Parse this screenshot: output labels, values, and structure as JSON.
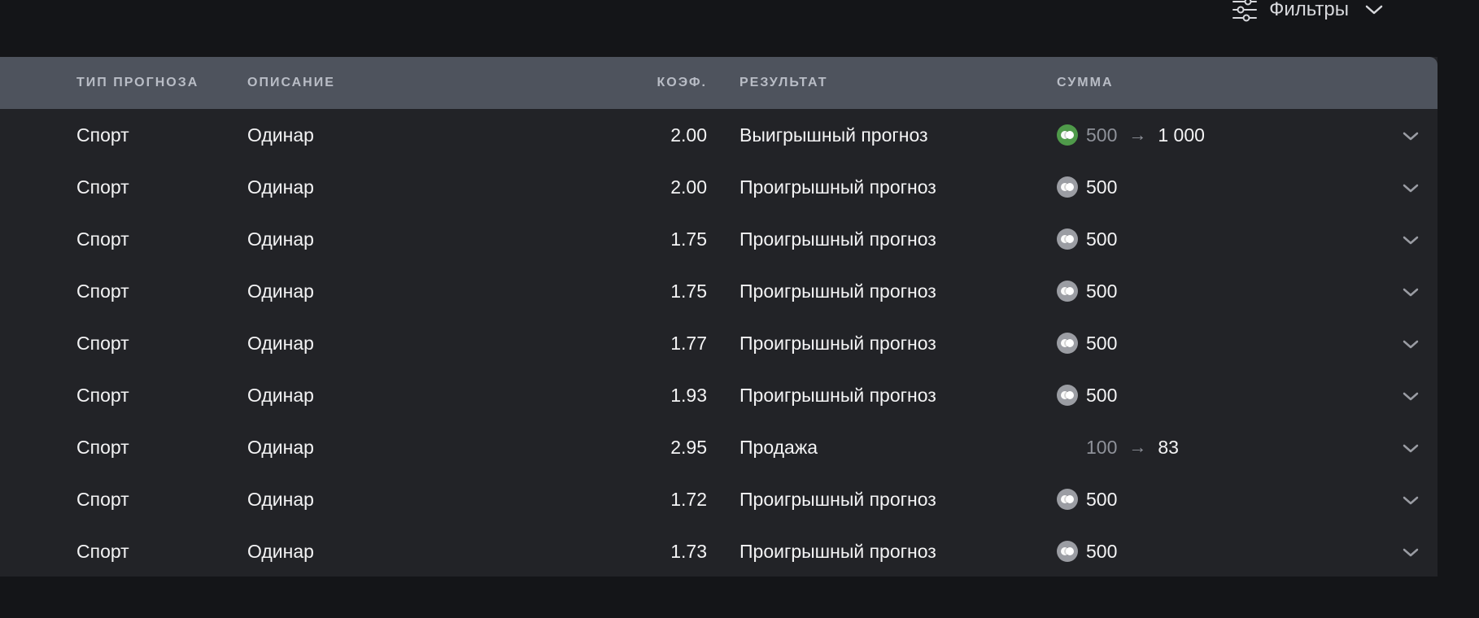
{
  "toolbar": {
    "filters_label": "Фильтры"
  },
  "table": {
    "headers": {
      "type": "ТИП ПРОГНОЗА",
      "description": "ОПИСАНИЕ",
      "coef": "КОЭФ.",
      "result": "РЕЗУЛЬТАТ",
      "sum": "СУММА"
    },
    "rows": [
      {
        "type": "Спорт",
        "description": "Одинар",
        "coef": "2.00",
        "result": "Выигрышный прогноз",
        "coin": "green",
        "amount": "500",
        "payout": "1 000"
      },
      {
        "type": "Спорт",
        "description": "Одинар",
        "coef": "2.00",
        "result": "Проигрышный прогноз",
        "coin": "gray",
        "amount": "500",
        "payout": null
      },
      {
        "type": "Спорт",
        "description": "Одинар",
        "coef": "1.75",
        "result": "Проигрышный прогноз",
        "coin": "gray",
        "amount": "500",
        "payout": null
      },
      {
        "type": "Спорт",
        "description": "Одинар",
        "coef": "1.75",
        "result": "Проигрышный прогноз",
        "coin": "gray",
        "amount": "500",
        "payout": null
      },
      {
        "type": "Спорт",
        "description": "Одинар",
        "coef": "1.77",
        "result": "Проигрышный прогноз",
        "coin": "gray",
        "amount": "500",
        "payout": null
      },
      {
        "type": "Спорт",
        "description": "Одинар",
        "coef": "1.93",
        "result": "Проигрышный прогноз",
        "coin": "gray",
        "amount": "500",
        "payout": null
      },
      {
        "type": "Спорт",
        "description": "Одинар",
        "coef": "2.95",
        "result": "Продажа",
        "coin": null,
        "amount": "100",
        "payout": "83"
      },
      {
        "type": "Спорт",
        "description": "Одинар",
        "coef": "1.72",
        "result": "Проигрышный прогноз",
        "coin": "gray",
        "amount": "500",
        "payout": null
      },
      {
        "type": "Спорт",
        "description": "Одинар",
        "coef": "1.73",
        "result": "Проигрышный прогноз",
        "coin": "gray",
        "amount": "500",
        "payout": null
      }
    ]
  },
  "colors": {
    "coin_green": "#4f9a4a",
    "coin_gray": "#9b9da3",
    "header_bg": "#4e535d",
    "table_bg": "#222327",
    "page_bg": "#141518"
  },
  "icons": {
    "filters": "sliders-icon",
    "dropdown": "chevron-down-icon",
    "coin": "coin-icon",
    "arrow": "→"
  }
}
